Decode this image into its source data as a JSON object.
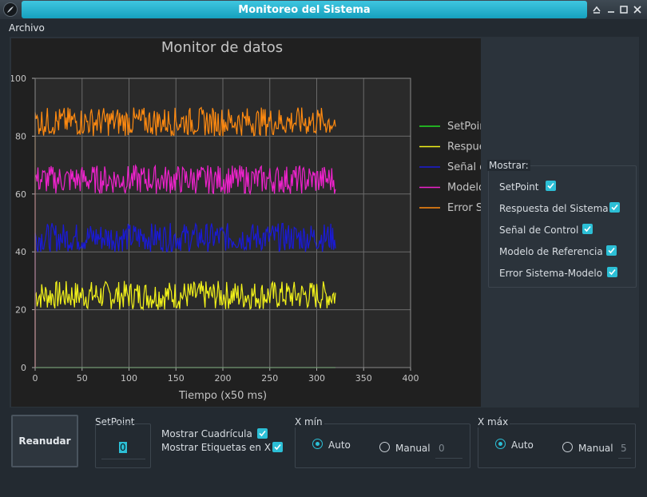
{
  "window": {
    "title": "Monitoreo del Sistema"
  },
  "menu": {
    "archivo": "Archivo"
  },
  "chart_data": {
    "type": "line",
    "title": "Monitor de datos",
    "xlabel": "Tiempo (x50 ms)",
    "ylabel": "",
    "xlim": [
      0,
      400
    ],
    "ylim": [
      0,
      100
    ],
    "xticks": [
      "0",
      "50",
      "100",
      "150",
      "200",
      "250",
      "300",
      "350",
      "400"
    ],
    "yticks": [
      "0",
      "20",
      "40",
      "60",
      "80",
      "100"
    ],
    "grid": true,
    "legend_position": "right",
    "x_last": 320,
    "series": [
      {
        "name": "SetPoint",
        "color": "#22dd22",
        "level": 0,
        "min": 0,
        "max": 0
      },
      {
        "name": "Respuesta del Sistema",
        "color": "#f2f21a",
        "level": 25,
        "min": 20,
        "max": 30
      },
      {
        "name": "Señal de Control",
        "color": "#1a1ad8",
        "level": 45,
        "min": 40,
        "max": 50
      },
      {
        "name": "Modelo de Referencia",
        "color": "#ee22cc",
        "level": 65,
        "min": 60,
        "max": 70
      },
      {
        "name": "Error Sistema-Modelo",
        "color": "#ff8a10",
        "level": 85,
        "min": 80,
        "max": 90
      }
    ],
    "legend_labels": [
      "SetPoint",
      "Respuesta",
      "Señal d",
      "Modelo",
      "Error S"
    ]
  },
  "mostrar": {
    "title": "Mostrar:",
    "items": [
      {
        "label": "SetPoint",
        "checked": true
      },
      {
        "label": "Respuesta del Sistema",
        "checked": true
      },
      {
        "label": "Señal de Control",
        "checked": true
      },
      {
        "label": "Modelo de Referencia",
        "checked": true
      },
      {
        "label": "Error Sistema-Modelo",
        "checked": true
      }
    ]
  },
  "controls": {
    "reanudar": "Reanudar",
    "setpoint_label": "SetPoint",
    "setpoint_value": "0",
    "mostrar_cuadricula": "Mostrar Cuadrícula",
    "mostrar_etiquetas": "Mostrar Etiquetas en X",
    "xmin": {
      "title": "X mín",
      "auto": "Auto",
      "manual": "Manual",
      "value": "0",
      "selected": "Auto"
    },
    "xmax": {
      "title": "X máx",
      "auto": "Auto",
      "manual": "Manual",
      "value": "5",
      "selected": "Auto"
    }
  }
}
